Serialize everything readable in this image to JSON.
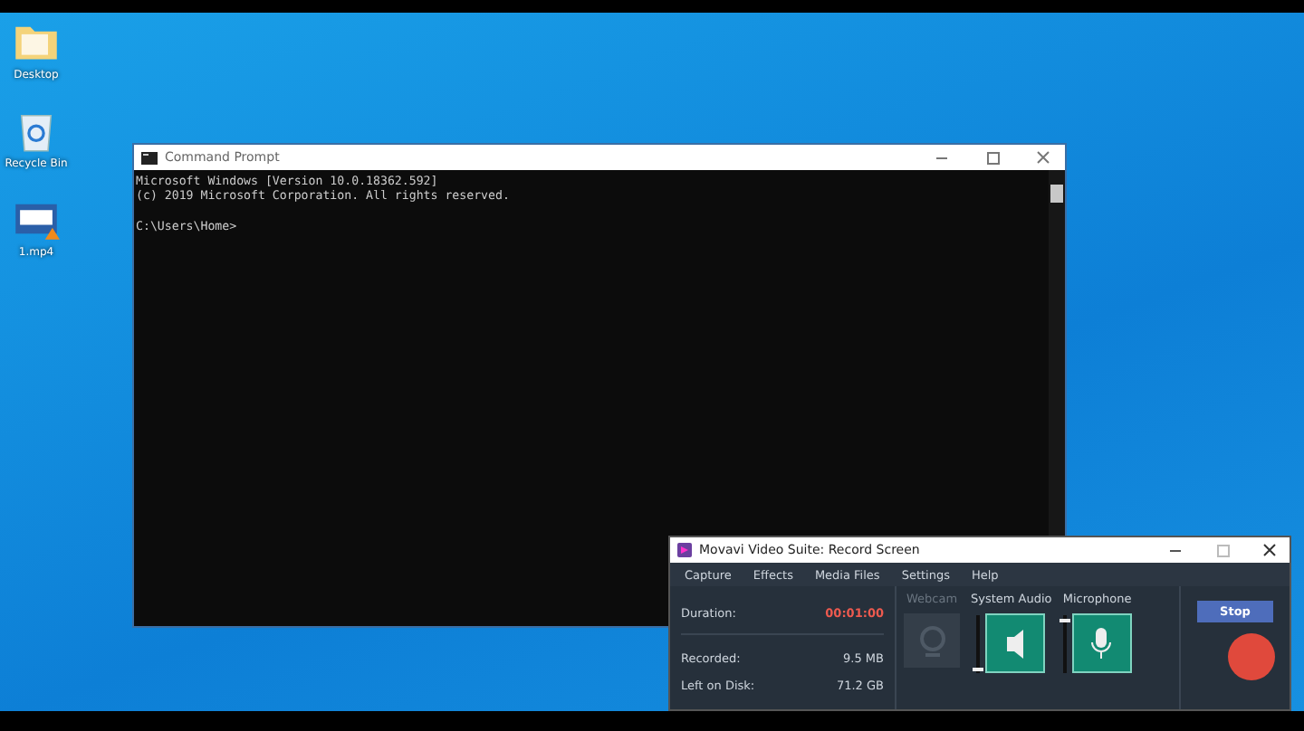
{
  "desktop_icons": [
    {
      "kind": "folder",
      "label": "Desktop"
    },
    {
      "kind": "bin",
      "label": "Recycle Bin"
    },
    {
      "kind": "video",
      "label": "1.mp4"
    }
  ],
  "command_prompt": {
    "title": "Command Prompt",
    "lines": [
      "Microsoft Windows [Version 10.0.18362.592]",
      "(c) 2019 Microsoft Corporation. All rights reserved."
    ],
    "prompt": "C:\\Users\\Home>"
  },
  "recorder": {
    "title": "Movavi Video Suite: Record Screen",
    "menu": [
      "Capture",
      "Effects",
      "Media Files",
      "Settings",
      "Help"
    ],
    "stats": [
      {
        "label": "Duration:",
        "value": "00:01:00",
        "highlight": true
      },
      {
        "label": "Recorded:",
        "value": "9.5 MB",
        "highlight": false
      },
      {
        "label": "Left on Disk:",
        "value": "71.2 GB",
        "highlight": false
      }
    ],
    "sources": [
      {
        "kind": "webcam",
        "label": "Webcam",
        "disabled": true
      },
      {
        "kind": "speaker",
        "label": "System Audio",
        "disabled": false,
        "on": true,
        "level": 0.05
      },
      {
        "kind": "mic",
        "label": "Microphone",
        "disabled": false,
        "on": true,
        "level": 0.95
      }
    ],
    "stop_button": "Stop"
  }
}
